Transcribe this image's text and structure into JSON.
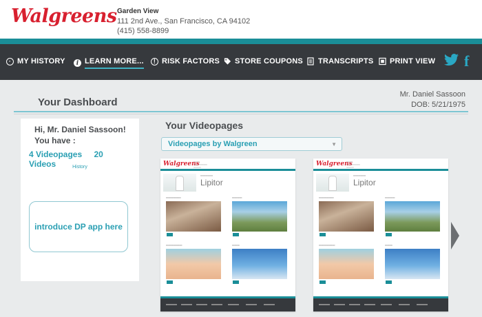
{
  "header": {
    "logo": "Walgreens",
    "store_name": "Garden View",
    "address": "111 2nd Ave., San Francisco, CA 94102",
    "phone": "(415) 558-8899"
  },
  "nav": {
    "items": [
      {
        "label": "MY HISTORY",
        "icon": "clock-icon"
      },
      {
        "label": "LEARN MORE...",
        "icon": "info-icon"
      },
      {
        "label": "RISK FACTORS",
        "icon": "alert-icon"
      },
      {
        "label": "STORE COUPONS",
        "icon": "tag-icon"
      },
      {
        "label": "TRANSCRIPTS",
        "icon": "document-icon"
      },
      {
        "label": "PRINT VIEW",
        "icon": "print-icon"
      }
    ],
    "active": "LEARN MORE...",
    "twitter_icon": "twitter-icon",
    "facebook_icon": "facebook-icon"
  },
  "dashboard": {
    "title": "Your Dashboard",
    "user_name": "Mr. Daniel Sassoon",
    "dob": "DOB: 5/21/1975"
  },
  "left_panel": {
    "greeting": "Hi, Mr. Daniel Sassoon!",
    "you_have": "You have :",
    "videopages_count": "4 Videopages",
    "videos_count": "20 Videos",
    "history_link": "History",
    "intro_box": "introduce DP app here"
  },
  "videopages": {
    "title": "Your Videopages",
    "select_value": "Videopages by Walgreen",
    "cards": [
      {
        "logo": "Walgreens",
        "drug": "Lipitor"
      },
      {
        "logo": "Walgreens",
        "drug": "Lipitor"
      }
    ]
  },
  "colors": {
    "brand_red": "#d8202f",
    "teal": "#1a8e98",
    "nav_bg": "#36393d",
    "accent_blue": "#2a9fb3"
  }
}
